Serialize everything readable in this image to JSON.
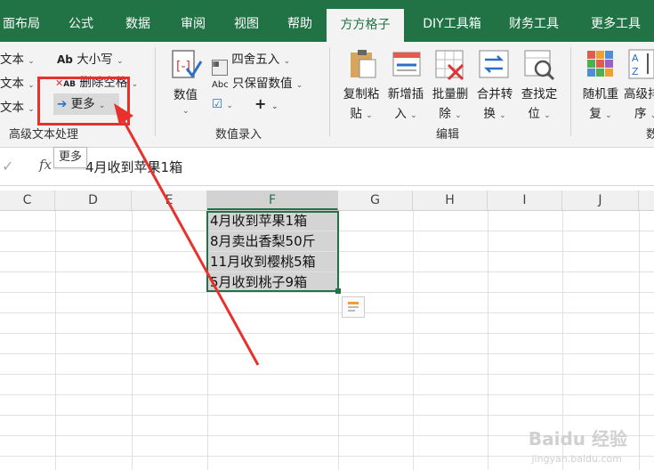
{
  "tabs": [
    {
      "label": "面布局"
    },
    {
      "label": "公式"
    },
    {
      "label": "数据"
    },
    {
      "label": "审阅"
    },
    {
      "label": "视图"
    },
    {
      "label": "帮助"
    },
    {
      "label": "方方格子",
      "active": true
    },
    {
      "label": "DIY工具箱"
    },
    {
      "label": "财务工具"
    },
    {
      "label": "更多工具"
    }
  ],
  "ribbon": {
    "text_group": {
      "left_items": [
        "文本",
        "文本",
        "文本"
      ],
      "case_label": "大小写",
      "case_prefix": "Ab",
      "delete_space_label": "删除空格",
      "more_label": "更多",
      "group_label": "高级文本处理"
    },
    "number_group": {
      "numeric_label": "数值",
      "round_label": "四舍五入",
      "keep_value_label": "只保留数值",
      "keep_value_prefix": "Abc",
      "plus_symbol": "+",
      "group_label": "数值录入"
    },
    "edit_group": {
      "buttons": [
        {
          "line1": "复制粘",
          "line2": "贴"
        },
        {
          "line1": "新增插",
          "line2": "入"
        },
        {
          "line1": "批量删",
          "line2": "除"
        },
        {
          "line1": "合并转",
          "line2": "换"
        },
        {
          "line1": "查找定",
          "line2": "位"
        }
      ],
      "group_label": "编辑"
    },
    "sort_group": {
      "buttons": [
        {
          "line1": "随机重",
          "line2": "复"
        },
        {
          "line1": "高级排",
          "line2": "序"
        }
      ],
      "group_label": "数"
    }
  },
  "formula_bar": {
    "fx": "fx",
    "check": "✓",
    "content": "4月收到苹果1箱"
  },
  "tooltip": "更多",
  "columns": [
    "C",
    "D",
    "E",
    "F",
    "G",
    "H",
    "I",
    "J"
  ],
  "selected_column": "F",
  "cells": [
    "4月收到苹果1箱",
    "8月卖出香梨50斤",
    "11月收到樱桃5箱",
    "5月收到桃子9箱"
  ],
  "watermark": {
    "main": "Baidu 经验",
    "sub": "jingyan.baidu.com"
  },
  "colors": {
    "ribbon_green": "#217346",
    "highlight_red": "#e8312c",
    "selection_gray": "#d4d4d4"
  }
}
